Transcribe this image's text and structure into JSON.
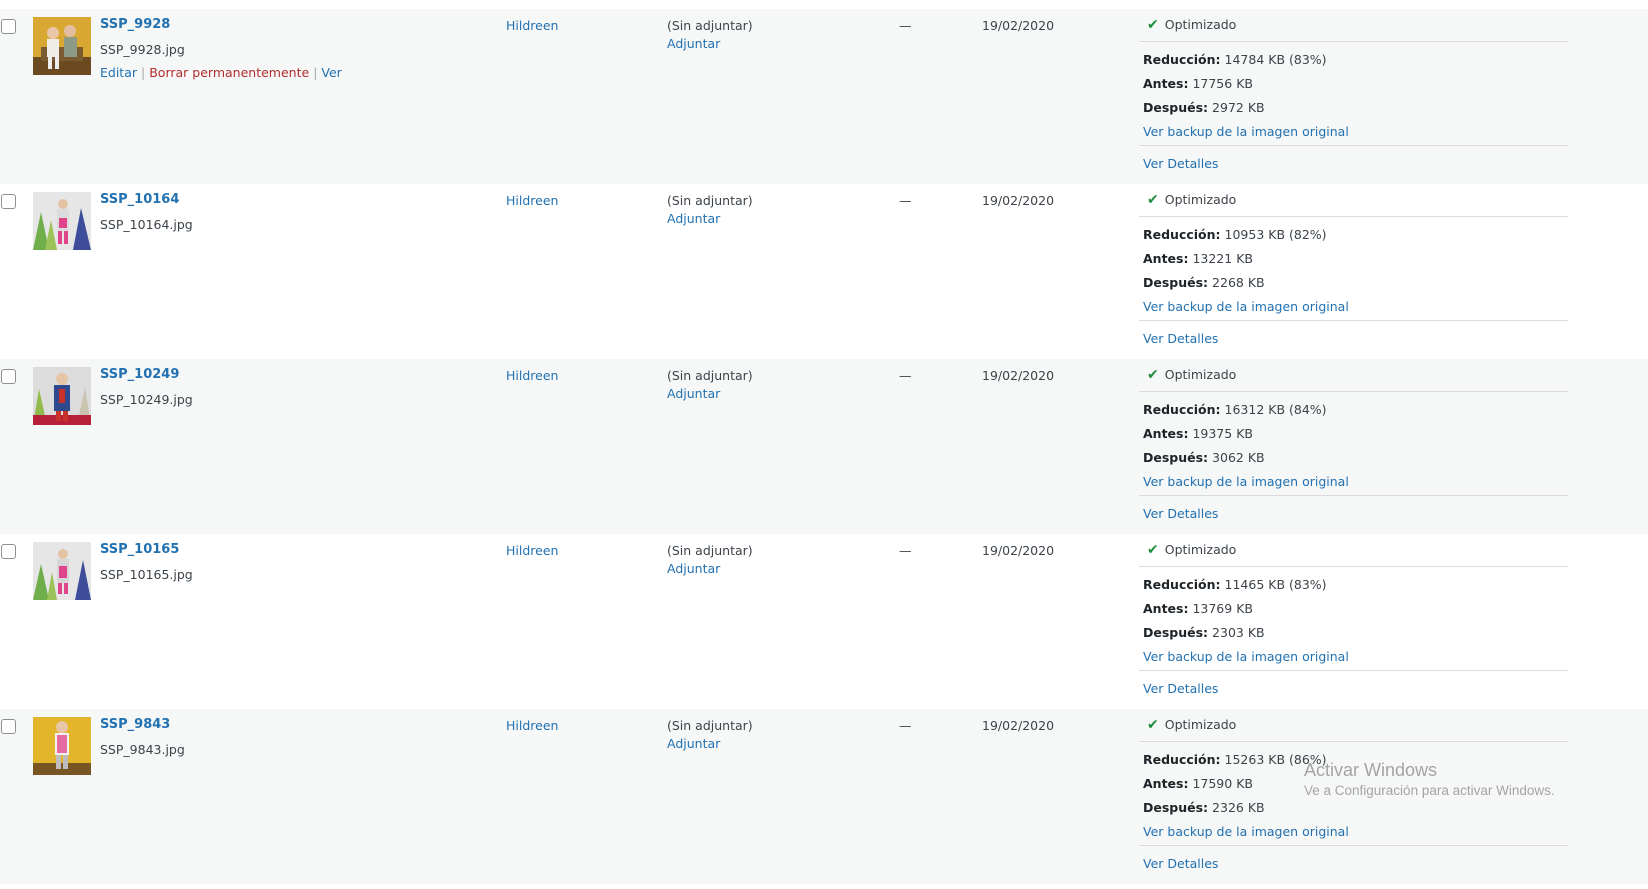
{
  "rows": [
    {
      "title": "SSP_9928",
      "filename": "SSP_9928.jpg",
      "actions": {
        "edit": "Editar",
        "delete": "Borrar permanentemente",
        "view": "Ver"
      },
      "author": "Hildreen",
      "attached_to": "(Sin adjuntar)",
      "attach_label": "Adjuntar",
      "comments": "—",
      "date": "19/02/2020",
      "status": "Optimizado",
      "reduction_label": "Reducción:",
      "reduction_value": "14784 KB (83%)",
      "before_label": "Antes:",
      "before_value": "17756 KB",
      "after_label": "Después:",
      "after_value": "2972 KB",
      "backup_link": "Ver backup de la imagen original",
      "details_link": "Ver Detalles",
      "thumb_bg": "#d9a832",
      "thumb_icon": "photo-two-children-on-sofa"
    },
    {
      "title": "SSP_10164",
      "filename": "SSP_10164.jpg",
      "author": "Hildreen",
      "attached_to": "(Sin adjuntar)",
      "attach_label": "Adjuntar",
      "comments": "—",
      "date": "19/02/2020",
      "status": "Optimizado",
      "reduction_label": "Reducción:",
      "reduction_value": "10953 KB (82%)",
      "before_label": "Antes:",
      "before_value": "13221 KB",
      "after_label": "Después:",
      "after_value": "2268 KB",
      "backup_link": "Ver backup de la imagen original",
      "details_link": "Ver Detalles",
      "thumb_bg": "#e6e6e6",
      "thumb_icon": "photo-child-with-trees"
    },
    {
      "title": "SSP_10249",
      "filename": "SSP_10249.jpg",
      "author": "Hildreen",
      "attached_to": "(Sin adjuntar)",
      "attach_label": "Adjuntar",
      "comments": "—",
      "date": "19/02/2020",
      "status": "Optimizado",
      "reduction_label": "Reducción:",
      "reduction_value": "16312 KB (84%)",
      "before_label": "Antes:",
      "before_value": "19375 KB",
      "after_label": "Después:",
      "after_value": "3062 KB",
      "backup_link": "Ver backup de la imagen original",
      "details_link": "Ver Detalles",
      "thumb_bg": "#dcdcdc",
      "thumb_icon": "photo-child-in-blue-coat"
    },
    {
      "title": "SSP_10165",
      "filename": "SSP_10165.jpg",
      "author": "Hildreen",
      "attached_to": "(Sin adjuntar)",
      "attach_label": "Adjuntar",
      "comments": "—",
      "date": "19/02/2020",
      "status": "Optimizado",
      "reduction_label": "Reducción:",
      "reduction_value": "11465 KB (83%)",
      "before_label": "Antes:",
      "before_value": "13769 KB",
      "after_label": "Después:",
      "after_value": "2303 KB",
      "backup_link": "Ver backup de la imagen original",
      "details_link": "Ver Detalles",
      "thumb_bg": "#e6e6e6",
      "thumb_icon": "photo-child-with-trees"
    },
    {
      "title": "SSP_9843",
      "filename": "SSP_9843.jpg",
      "author": "Hildreen",
      "attached_to": "(Sin adjuntar)",
      "attach_label": "Adjuntar",
      "comments": "—",
      "date": "19/02/2020",
      "status": "Optimizado",
      "reduction_label": "Reducción:",
      "reduction_value": "15263 KB (86%)",
      "before_label": "Antes:",
      "before_value": "17590 KB",
      "after_label": "Después:",
      "after_value": "2326 KB",
      "backup_link": "Ver backup de la imagen original",
      "details_link": "Ver Detalles",
      "thumb_bg": "#e2b52a",
      "thumb_icon": "photo-child-in-pink-vest"
    }
  ],
  "watermark": {
    "title": "Activar Windows",
    "subtitle": "Ve a Configuración para activar Windows."
  },
  "colors": {
    "link": "#2271b1",
    "delete": "#b32d2e",
    "check": "#1e8c3e",
    "row_alt": "#f6f7f7"
  }
}
